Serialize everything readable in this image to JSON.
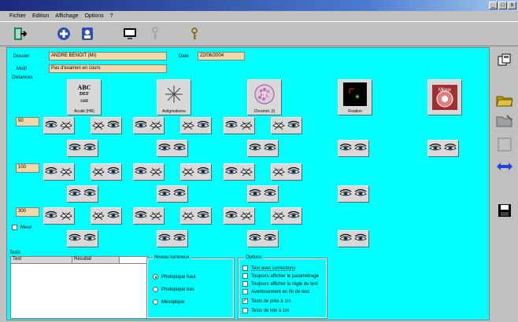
{
  "window": {
    "min": "_",
    "max": "□",
    "close": "x"
  },
  "menu": [
    "Fichier",
    "Edition",
    "Affichage",
    "Options",
    "?"
  ],
  "header": {
    "dossier_label": "Dossier",
    "dossier_value": "ANDRE BENOIT (Mr)",
    "date_label": "Date",
    "date_value": "22/06/2004",
    "motif_label": "Motif",
    "motif_value": "Pas d'examen en cours"
  },
  "distances": {
    "label": "Distances",
    "values": [
      "50",
      "100",
      "300"
    ],
    "meux_label": "Meux"
  },
  "tests_section": {
    "title": "Tests",
    "columns": [
      "Test",
      "Résultat"
    ]
  },
  "tiles": [
    {
      "caption": "Acuité (HR)",
      "text": "ABC\nDEF\nGHI"
    },
    {
      "caption": "Astigmatisme",
      "text": "✳"
    },
    {
      "caption": "Chromet. (I)",
      "text": ""
    },
    {
      "caption": "Fixation",
      "text": ""
    },
    {
      "caption": "",
      "text": "Mireix"
    }
  ],
  "niveau": {
    "title": "Niveau lumineux",
    "options": [
      "Photopique haut",
      "Photopique bas",
      "Mésopique"
    ],
    "selected": 0
  },
  "options": {
    "title": "Options",
    "items": [
      {
        "label": "Test avec corrections",
        "checked": false
      },
      {
        "label": "Toujours afficher le paramétrage",
        "checked": false
      },
      {
        "label": "Toujours afficher la règle du test",
        "checked": false
      },
      {
        "label": "Avertissement en fin de test",
        "checked": false
      },
      {
        "label": "Tests de près à 1m",
        "checked": true
      },
      {
        "label": "Tests de loin à 1m",
        "checked": false
      }
    ]
  },
  "colors": {
    "background": "#00ffff",
    "field": "#f0d8a8",
    "titlebar": "#1a2a7a"
  }
}
